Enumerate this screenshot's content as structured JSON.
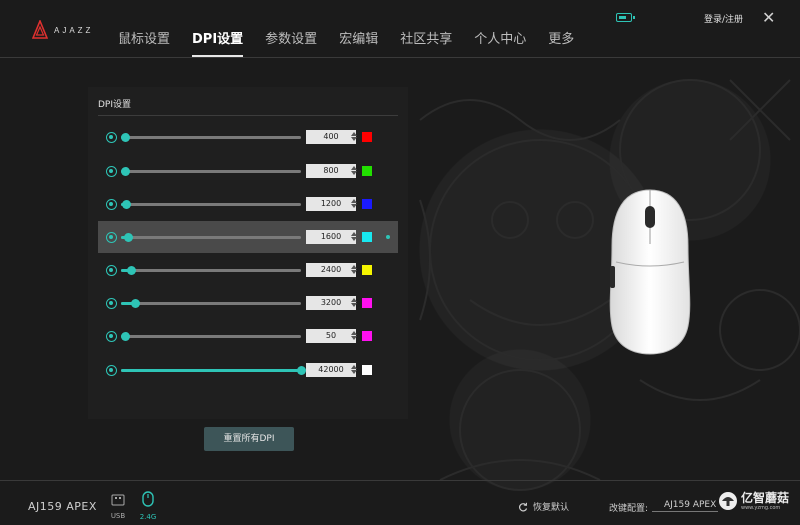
{
  "header": {
    "brand": "AJAZZ",
    "nav": [
      {
        "label": "鼠标设置",
        "active": false
      },
      {
        "label": "DPI设置",
        "active": true
      },
      {
        "label": "参数设置",
        "active": false
      },
      {
        "label": "宏编辑",
        "active": false
      },
      {
        "label": "社区共享",
        "active": false
      },
      {
        "label": "个人中心",
        "active": false
      },
      {
        "label": "更多",
        "active": false
      }
    ],
    "login": "登录/注册",
    "close": "✕"
  },
  "panel": {
    "title": "DPI设置",
    "max_dpi": 42000,
    "rows": [
      {
        "value": "400",
        "color": "#ff0000",
        "level": 400,
        "selected": false
      },
      {
        "value": "800",
        "color": "#22e000",
        "level": 800,
        "selected": false
      },
      {
        "value": "1200",
        "color": "#1a1aff",
        "level": 1200,
        "selected": false
      },
      {
        "value": "1600",
        "color": "#18e8f0",
        "level": 1600,
        "selected": true
      },
      {
        "value": "2400",
        "color": "#f5f500",
        "level": 2400,
        "selected": false
      },
      {
        "value": "3200",
        "color": "#ff10f0",
        "level": 3200,
        "selected": false
      },
      {
        "value": "50",
        "color": "#ff10f0",
        "level": 50,
        "selected": false
      },
      {
        "value": "42000",
        "color": "#ffffff",
        "level": 42000,
        "selected": false
      }
    ]
  },
  "reset_label": "重置所有DPI",
  "footer": {
    "device": "AJ159 APEX",
    "usb_label": "USB",
    "wireless_label": "2.4G",
    "restore": "恢复默认",
    "config_label": "改键配置:",
    "config_value": "AJ159 APEX",
    "watermark": "亿智蘑菇",
    "watermark_sub": "www.yzmg.com"
  },
  "colors": {
    "accent": "#2ec4b6",
    "bg": "#1c1c1c"
  }
}
